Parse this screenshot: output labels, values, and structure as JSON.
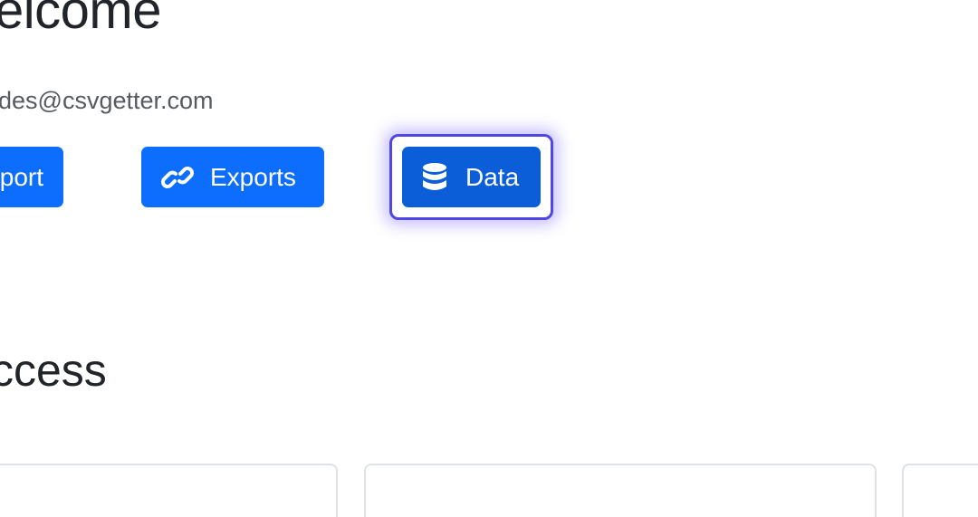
{
  "header": {
    "title": "elcome",
    "email": "des@csvgetter.com"
  },
  "actions": {
    "import_label": "port",
    "exports_label": "Exports",
    "data_label": "Data",
    "exports_icon": "link-icon",
    "data_icon": "database-icon"
  },
  "section": {
    "title": "ccess"
  },
  "colors": {
    "primary": "#0d6efd",
    "primary_active": "#0b5ed7",
    "focus_ring": "#4f46e5"
  }
}
